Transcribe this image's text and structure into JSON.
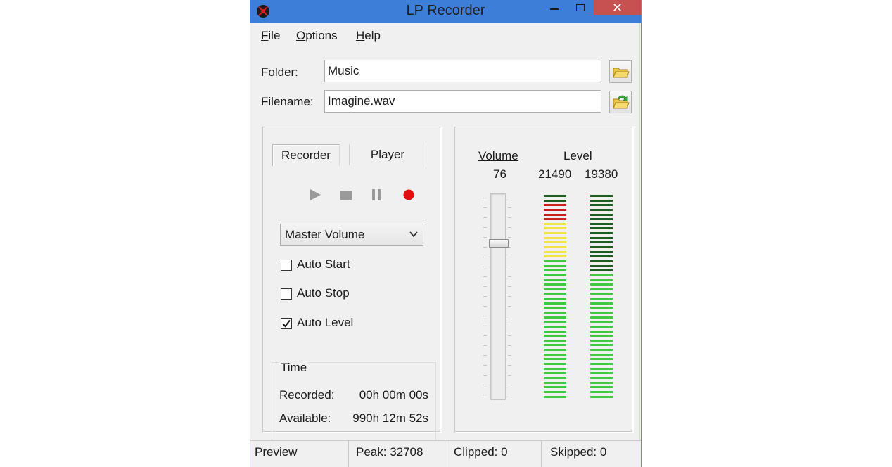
{
  "window": {
    "title": "LP Recorder",
    "close_glyph": "✕"
  },
  "menu": [
    {
      "label": "File",
      "accel": "F"
    },
    {
      "label": "Options",
      "accel": "O"
    },
    {
      "label": "Help",
      "accel": "H"
    }
  ],
  "folder": {
    "label": "Folder:",
    "value": "Music"
  },
  "filename": {
    "label": "Filename:",
    "value": "Imagine.wav"
  },
  "tabs": [
    {
      "label": "Recorder",
      "active": true
    },
    {
      "label": "Player",
      "active": false
    }
  ],
  "transport": [
    "play-icon",
    "stop-icon",
    "pause-icon",
    "record-icon"
  ],
  "source": {
    "selected": "Master Volume"
  },
  "options": [
    {
      "label": "Auto Start",
      "checked": false
    },
    {
      "label": "Auto Stop",
      "checked": false
    },
    {
      "label": "Auto Level",
      "checked": true
    }
  ],
  "time": {
    "title": "Time",
    "recorded_label": "Recorded:",
    "recorded_value": "00h 00m 00s",
    "available_label": "Available:",
    "available_value": "990h 12m 52s"
  },
  "meters": {
    "volume_label": "Volume",
    "volume_value": "76",
    "level_label": "Level",
    "left_level": "21490",
    "right_level": "19380",
    "volume_fraction": 0.76,
    "left_fill_fraction": 1.0,
    "right_fill_fraction": 0.62
  },
  "status": {
    "mode": "Preview",
    "peak": "Peak: 32708",
    "clipped": "Clipped: 0",
    "skipped": "Skipped: 0"
  },
  "colors": {
    "titlebar": "#3d7ed8",
    "close": "#c75050",
    "record": "#e01010",
    "meter_green": "#3ec93e",
    "meter_dark_green": "#1f5c1f",
    "meter_yellow": "#f2e34a",
    "meter_red": "#c81e1e"
  }
}
